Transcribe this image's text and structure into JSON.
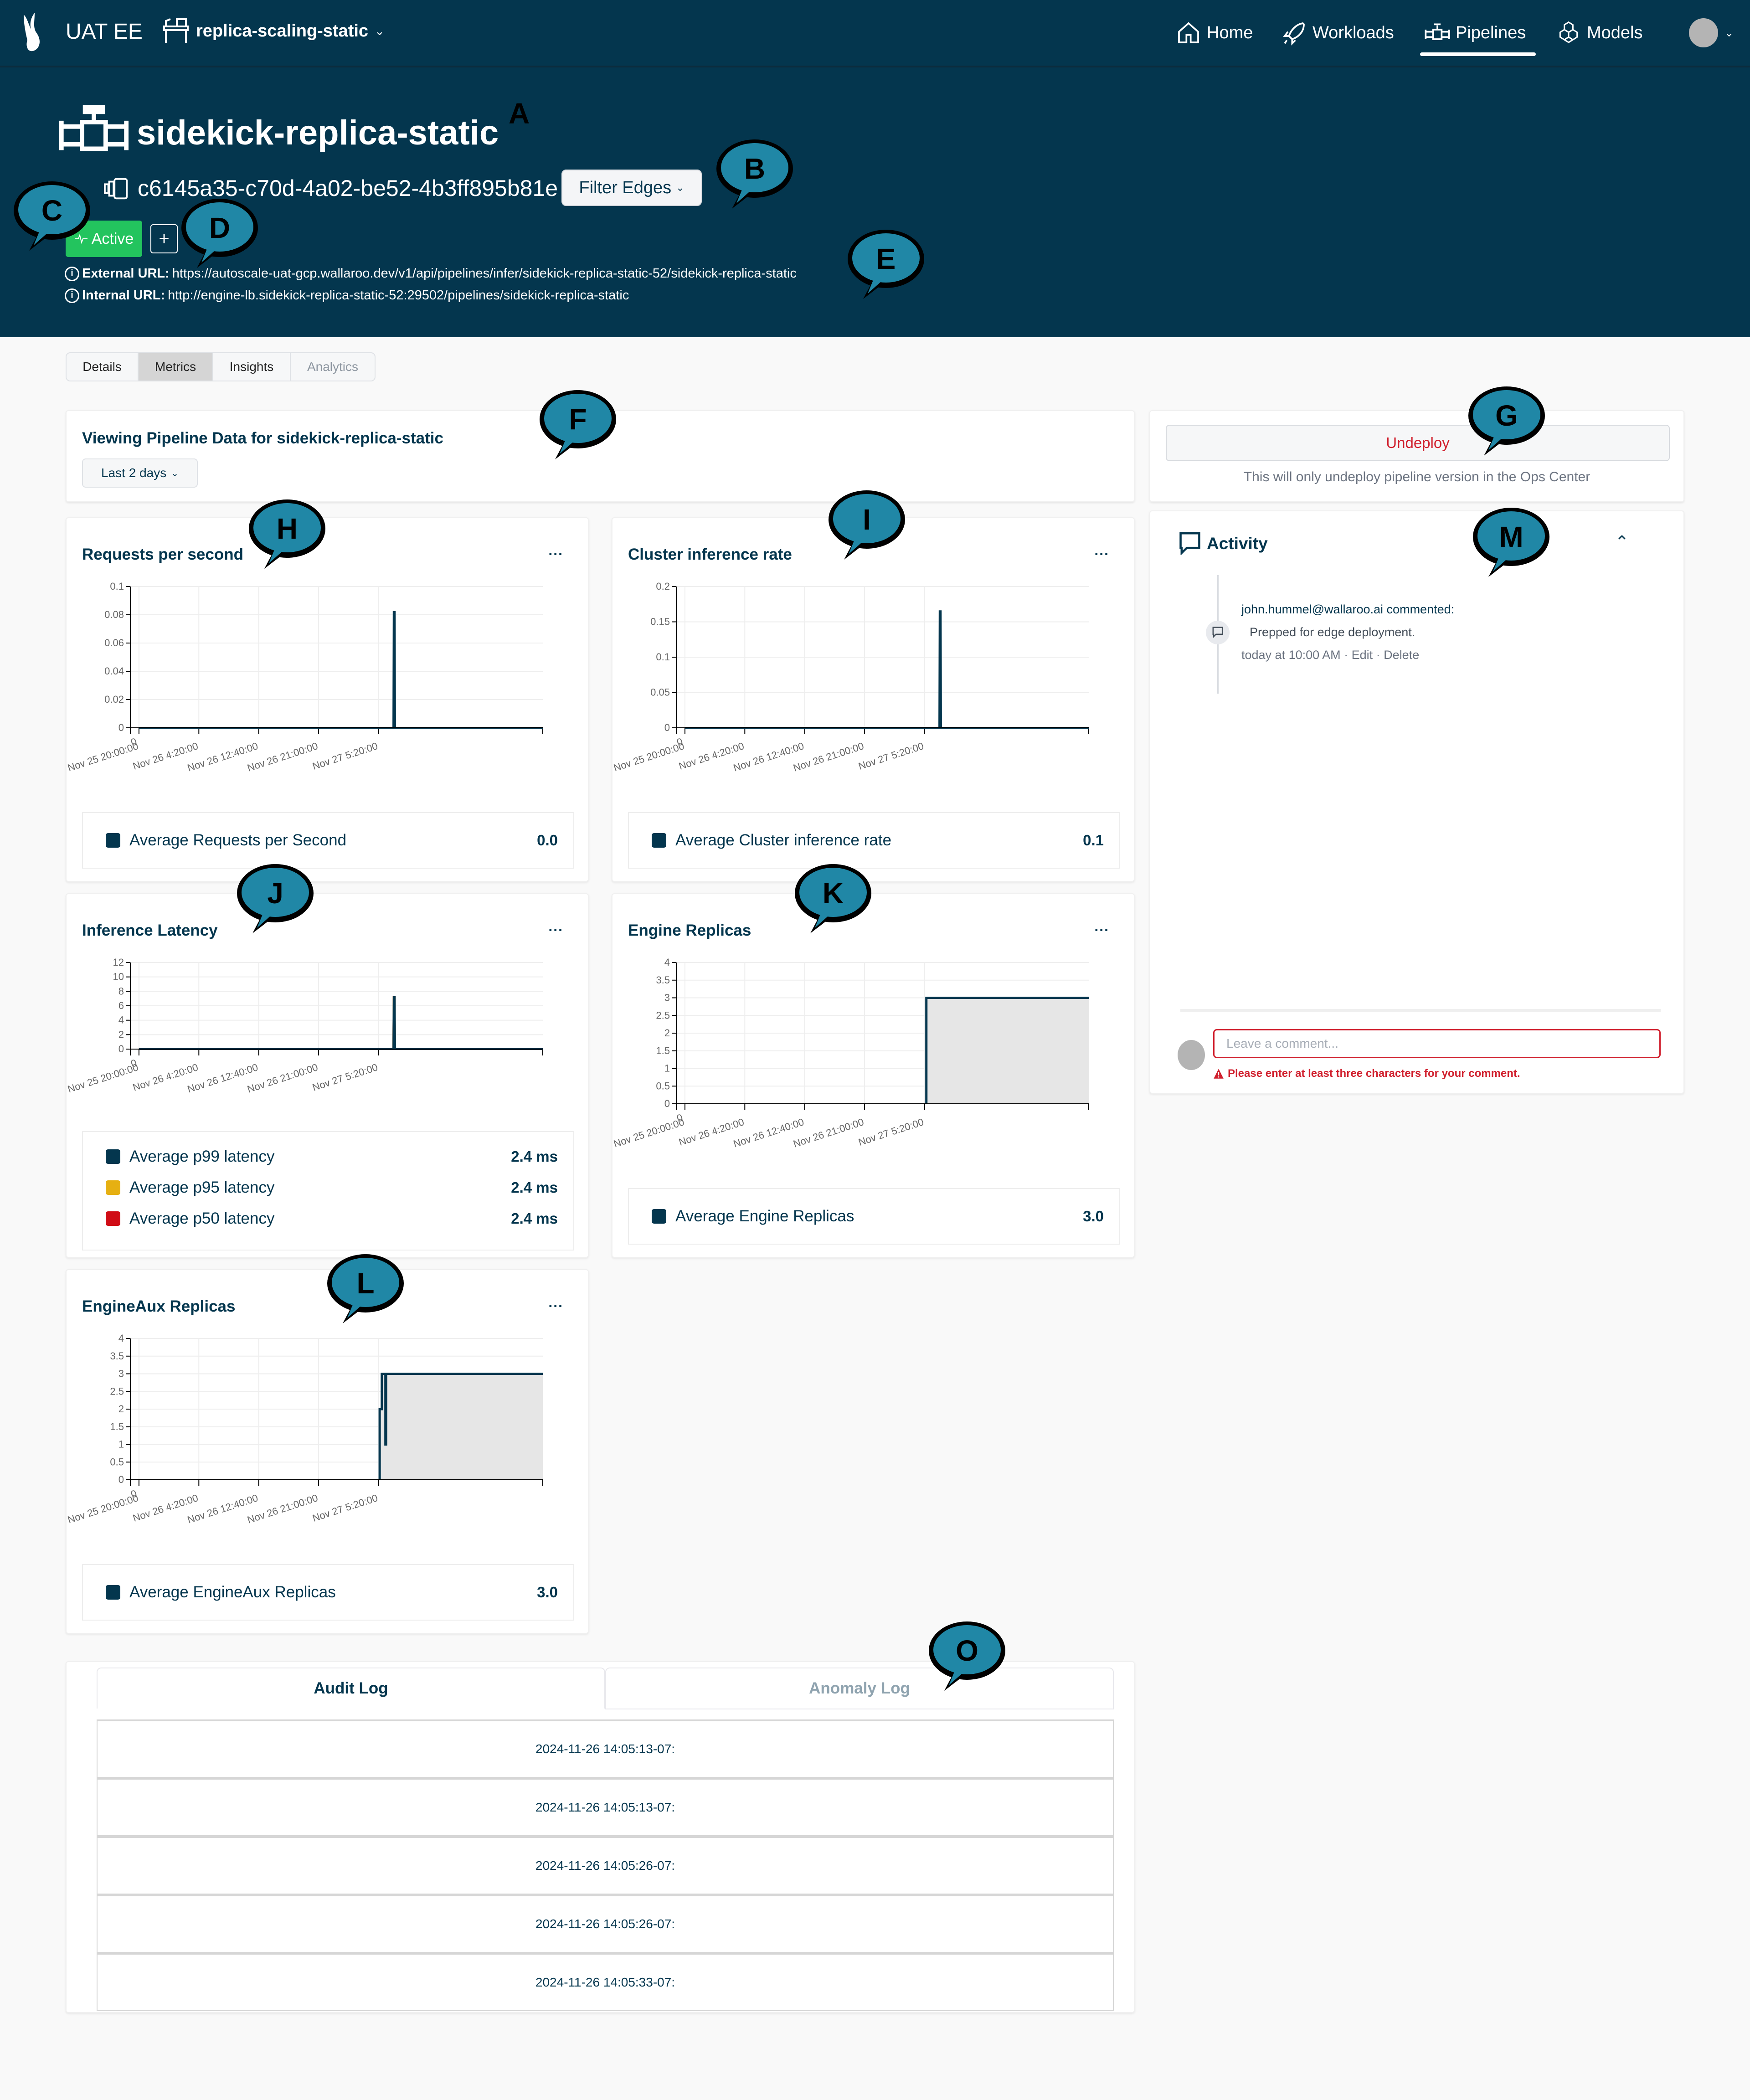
{
  "topbar": {
    "app_name": "UAT EE",
    "workspace": "replica-scaling-static",
    "nav": [
      {
        "label": "Home",
        "icon": "home-icon"
      },
      {
        "label": "Workloads",
        "icon": "rocket-icon"
      },
      {
        "label": "Pipelines",
        "icon": "pipeline-icon",
        "active": true
      },
      {
        "label": "Models",
        "icon": "cubes-icon"
      }
    ]
  },
  "pipeline": {
    "name": "sidekick-replica-static",
    "version_id": "c6145a35-c70d-4a02-be52-4b3ff895b81e",
    "filter_edges_label": "Filter Edges",
    "status_label": "Active",
    "add_label": "+",
    "external_url_label": "External URL:",
    "external_url": "https://autoscale-uat-gcp.wallaroo.dev/v1/api/pipelines/infer/sidekick-replica-static-52/sidekick-replica-static",
    "internal_url_label": "Internal URL:",
    "internal_url": "http://engine-lb.sidekick-replica-static-52:29502/pipelines/sidekick-replica-static"
  },
  "tabs": [
    {
      "label": "Details",
      "state": "normal"
    },
    {
      "label": "Metrics",
      "state": "active"
    },
    {
      "label": "Insights",
      "state": "normal"
    },
    {
      "label": "Analytics",
      "state": "disabled"
    }
  ],
  "info_card": {
    "title": "Viewing Pipeline Data for sidekick-replica-static",
    "range_label": "Last 2 days"
  },
  "undeploy": {
    "button_label": "Undeploy",
    "note": "This will only undeploy pipeline version in the Ops Center"
  },
  "activity": {
    "title": "Activity",
    "comments": [
      {
        "author_line": "john.hummel@wallaroo.ai commented:",
        "body": "Prepped for edge deployment.",
        "meta": "today at 10:00 AM · Edit · Delete"
      }
    ],
    "input_placeholder": "Leave a comment...",
    "error": "Please enter at least three characters for your comment."
  },
  "colors": {
    "header_bg": "#04364e",
    "series_navy": "#04364e",
    "p95_yellow": "#e6b012",
    "p50_red": "#d00c16",
    "active_green": "#23c45e",
    "error_red": "#d01f2d",
    "callout_teal": "#2087a6"
  },
  "chart_data": [
    {
      "id": "rps",
      "type": "line",
      "title": "Requests per second",
      "menu": "...",
      "x_ticks": [
        "Nov 25 20:00:00",
        "Nov 26 4:20:00",
        "Nov 26 12:40:00",
        "Nov 26 21:00:00",
        "Nov 27 5:20:00"
      ],
      "x_range_hours": [
        -1.2,
        56.2
      ],
      "y_ticks": [
        "0",
        "0.02",
        "0.04",
        "0.06",
        "0.08",
        "0.1"
      ],
      "ylim": [
        0,
        0.1
      ],
      "series": [
        {
          "name": "Average Requests per Second",
          "color": "#04364e",
          "summary": "0.0",
          "points": [
            [
              0,
              0
            ],
            [
              35.4,
              0
            ],
            [
              35.45,
              0.082
            ],
            [
              35.6,
              0.082
            ],
            [
              35.65,
              0
            ],
            [
              56.2,
              0
            ]
          ]
        }
      ]
    },
    {
      "id": "cluster",
      "type": "line",
      "title": "Cluster inference rate",
      "menu": "...",
      "x_ticks": [
        "Nov 25 20:00:00",
        "Nov 26 4:20:00",
        "Nov 26 12:40:00",
        "Nov 26 21:00:00",
        "Nov 27 5:20:00"
      ],
      "x_range_hours": [
        -1.2,
        56.2
      ],
      "y_ticks": [
        "0",
        "0.05",
        "0.1",
        "0.15",
        "0.2"
      ],
      "ylim": [
        0,
        0.2
      ],
      "series": [
        {
          "name": "Average Cluster inference rate",
          "color": "#04364e",
          "summary": "0.1",
          "points": [
            [
              0,
              0
            ],
            [
              35.4,
              0
            ],
            [
              35.45,
              0.165
            ],
            [
              35.6,
              0.165
            ],
            [
              35.65,
              0
            ],
            [
              56.2,
              0
            ]
          ]
        }
      ]
    },
    {
      "id": "latency",
      "type": "line",
      "title": "Inference Latency",
      "menu": "...",
      "x_ticks": [
        "Nov 25 20:00:00",
        "Nov 26 4:20:00",
        "Nov 26 12:40:00",
        "Nov 26 21:00:00",
        "Nov 27 5:20:00"
      ],
      "x_range_hours": [
        -1.2,
        56.2
      ],
      "y_ticks": [
        "0",
        "2",
        "4",
        "6",
        "8",
        "10",
        "12"
      ],
      "ylim": [
        0,
        12
      ],
      "series": [
        {
          "name": "Average p99 latency",
          "color": "#04364e",
          "summary": "2.4 ms",
          "points": [
            [
              0,
              0
            ],
            [
              35.4,
              0
            ],
            [
              35.45,
              7.2
            ],
            [
              35.6,
              7.2
            ],
            [
              35.65,
              0
            ],
            [
              56.2,
              0
            ]
          ]
        },
        {
          "name": "Average p95 latency",
          "color": "#e6b012",
          "summary": "2.4 ms",
          "points": [
            [
              0,
              0
            ],
            [
              35.4,
              0
            ],
            [
              35.45,
              7.2
            ],
            [
              35.6,
              7.2
            ],
            [
              35.65,
              0
            ],
            [
              56.2,
              0
            ]
          ]
        },
        {
          "name": "Average p50 latency",
          "color": "#d00c16",
          "summary": "2.4 ms",
          "points": [
            [
              0,
              0
            ],
            [
              35.4,
              0
            ],
            [
              35.45,
              7.2
            ],
            [
              35.6,
              7.2
            ],
            [
              35.65,
              0
            ],
            [
              56.2,
              0
            ]
          ]
        }
      ]
    },
    {
      "id": "engine",
      "type": "area",
      "title": "Engine Replicas",
      "menu": "...",
      "x_ticks": [
        "Nov 25 20:00:00",
        "Nov 26 4:20:00",
        "Nov 26 12:40:00",
        "Nov 26 21:00:00",
        "Nov 27 5:20:00"
      ],
      "x_range_hours": [
        -1.2,
        56.2
      ],
      "y_ticks": [
        "0",
        "0.5",
        "1",
        "1.5",
        "2",
        "2.5",
        "3",
        "3.5",
        "4"
      ],
      "ylim": [
        0,
        4
      ],
      "series": [
        {
          "name": "Average Engine Replicas",
          "color": "#04364e",
          "summary": "3.0",
          "points": [
            [
              33.6,
              0
            ],
            [
              33.6,
              3
            ],
            [
              56.2,
              3
            ]
          ]
        }
      ]
    },
    {
      "id": "engineaux",
      "type": "area",
      "title": "EngineAux Replicas",
      "menu": "...",
      "x_ticks": [
        "Nov 25 20:00:00",
        "Nov 26 4:20:00",
        "Nov 26 12:40:00",
        "Nov 26 21:00:00",
        "Nov 27 5:20:00"
      ],
      "x_range_hours": [
        -1.2,
        56.2
      ],
      "y_ticks": [
        "0",
        "0.5",
        "1",
        "1.5",
        "2",
        "2.5",
        "3",
        "3.5",
        "4"
      ],
      "ylim": [
        0,
        4
      ],
      "series": [
        {
          "name": "Average EngineAux Replicas",
          "color": "#04364e",
          "summary": "3.0",
          "points": [
            [
              33.5,
              0
            ],
            [
              33.5,
              2
            ],
            [
              33.8,
              2
            ],
            [
              33.8,
              3
            ],
            [
              34.3,
              3
            ],
            [
              34.3,
              1
            ],
            [
              34.4,
              1
            ],
            [
              34.4,
              3
            ],
            [
              56.2,
              3
            ]
          ]
        }
      ]
    }
  ],
  "logs": {
    "tabs": [
      {
        "label": "Audit Log",
        "active": true
      },
      {
        "label": "Anomaly Log",
        "active": false
      }
    ],
    "rows": [
      "2024-11-26 14:05:13-07:",
      "2024-11-26 14:05:13-07:",
      "2024-11-26 14:05:26-07:",
      "2024-11-26 14:05:26-07:",
      "2024-11-26 14:05:33-07:"
    ]
  },
  "annotations": [
    "A",
    "B",
    "C",
    "D",
    "E",
    "F",
    "G",
    "H",
    "I",
    "J",
    "K",
    "L",
    "M",
    "O"
  ]
}
